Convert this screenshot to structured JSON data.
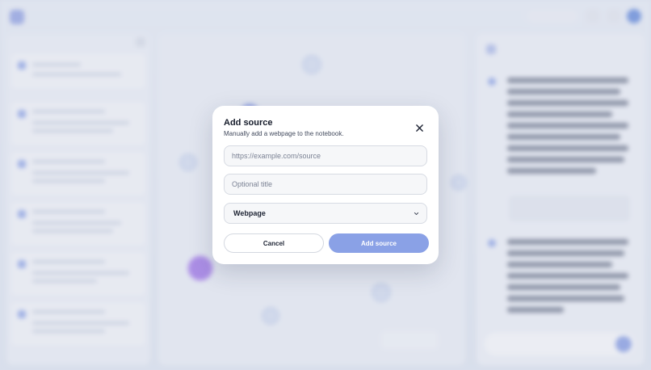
{
  "modal": {
    "title": "Add source",
    "description": "Manually add a webpage to the notebook.",
    "url_placeholder": "https://example.com/source",
    "title_placeholder": "Optional title",
    "type_value": "Webpage",
    "cancel_label": "Cancel",
    "submit_label": "Add source",
    "icons": {
      "close": "close-icon",
      "select": "chevron-down-icon"
    }
  },
  "colors": {
    "accent": "#8aa1e6",
    "modal_bg": "#ffffff",
    "field_bg": "#f6f7f9"
  }
}
